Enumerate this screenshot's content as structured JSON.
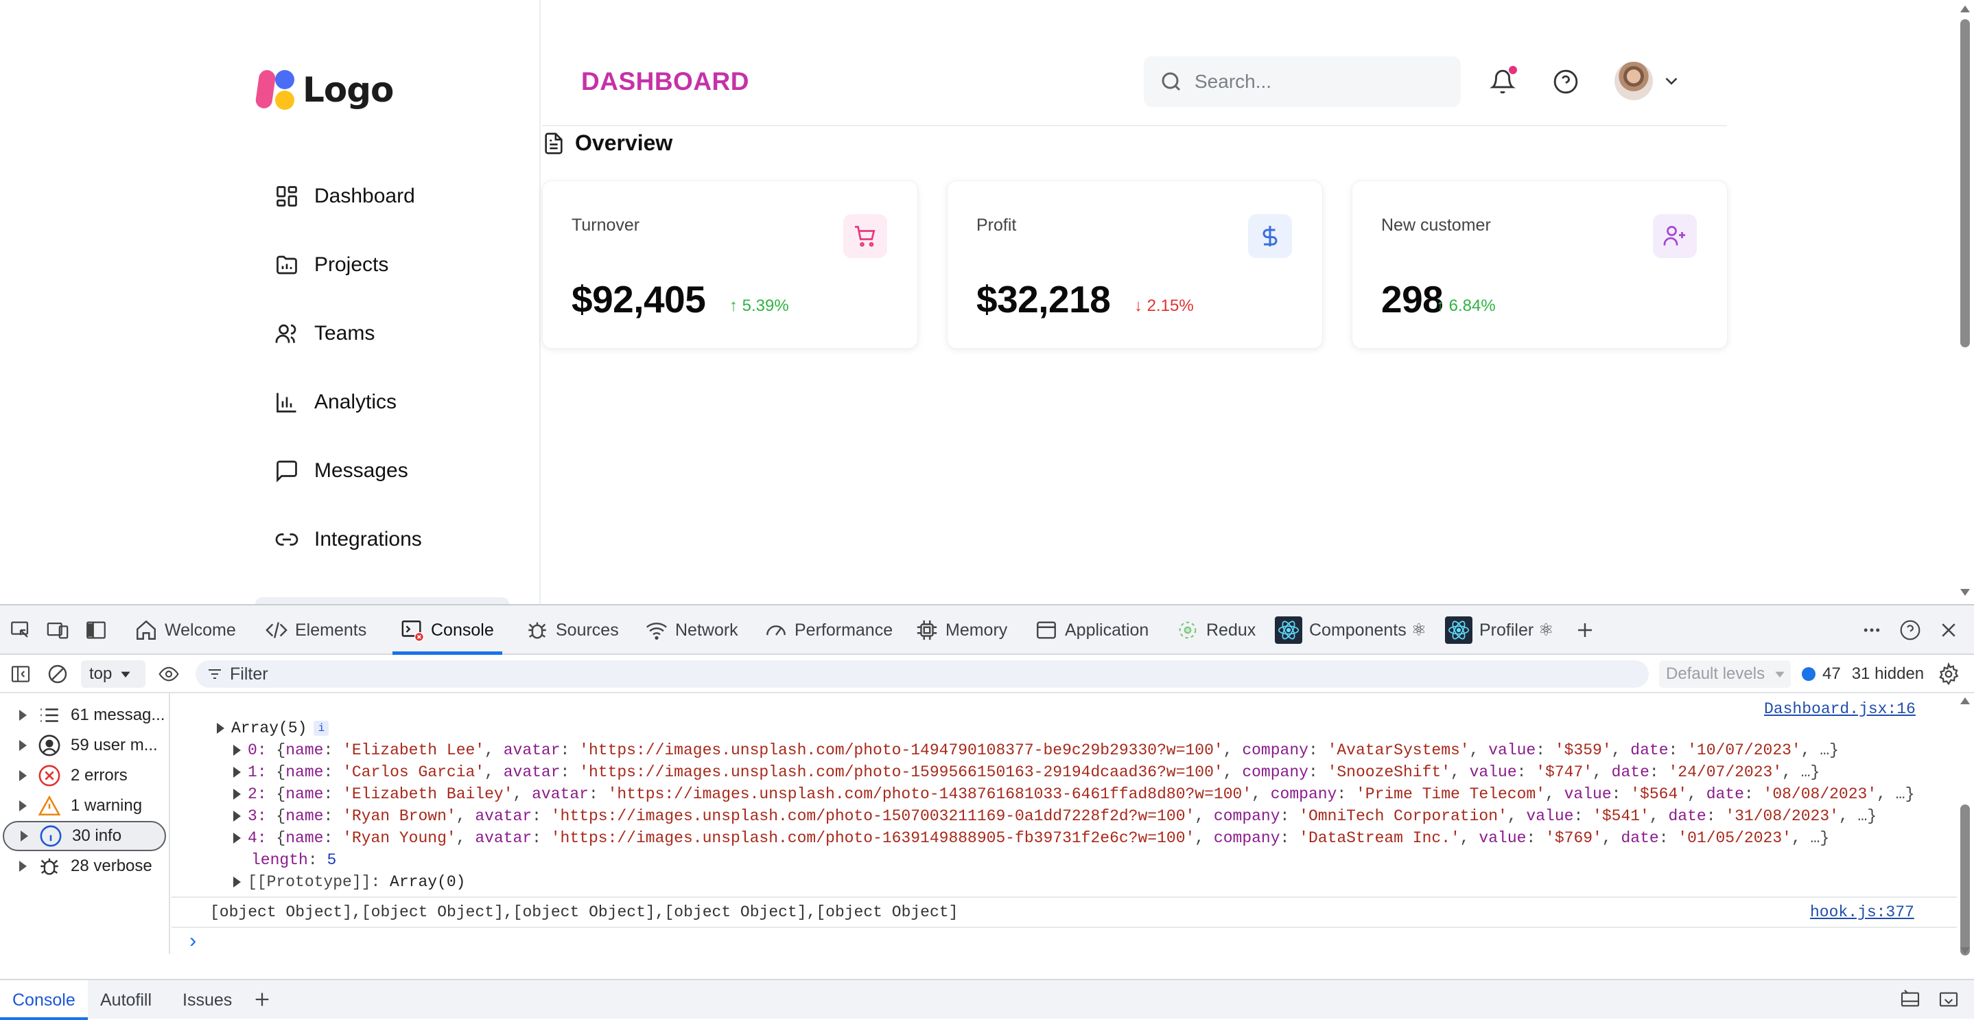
{
  "app": {
    "logo_text": "Logo",
    "nav": [
      {
        "label": "Dashboard",
        "icon": "grid-icon"
      },
      {
        "label": "Projects",
        "icon": "folder-chart-icon"
      },
      {
        "label": "Teams",
        "icon": "users-icon"
      },
      {
        "label": "Analytics",
        "icon": "bar-chart-icon"
      },
      {
        "label": "Messages",
        "icon": "message-square-icon"
      },
      {
        "label": "Integrations",
        "icon": "link-icon"
      }
    ],
    "page_title": "DASHBOARD",
    "search_placeholder": "Search...",
    "overview_title": "Overview",
    "cards": [
      {
        "title": "Turnover",
        "value": "$92,405",
        "change": "↑ 5.39%",
        "trend": "up",
        "icon": "shopping-cart-icon",
        "icon_color": "#e5397f",
        "icon_bg": "#fdecf3"
      },
      {
        "title": "Profit",
        "value": "$32,218",
        "change": "↓ 2.15%",
        "trend": "down",
        "icon": "dollar-icon",
        "icon_color": "#3b6fe0",
        "icon_bg": "#ebf1fd"
      },
      {
        "title": "New customer",
        "value": "298",
        "change": "↑ 6.84%",
        "trend": "up",
        "icon": "user-plus-icon",
        "icon_color": "#a347d6",
        "icon_bg": "#f5ecfb"
      }
    ],
    "colors": {
      "accent": "#c531a8",
      "up": "#2fb344",
      "down": "#e03131"
    }
  },
  "devtools": {
    "tabs": [
      {
        "label": "Welcome",
        "icon": "home-icon"
      },
      {
        "label": "Elements",
        "icon": "code-icon"
      },
      {
        "label": "Console",
        "icon": "console-icon",
        "active": true
      },
      {
        "label": "Sources",
        "icon": "bug-icon"
      },
      {
        "label": "Network",
        "icon": "wifi-icon"
      },
      {
        "label": "Performance",
        "icon": "gauge-icon"
      },
      {
        "label": "Memory",
        "icon": "chip-icon"
      },
      {
        "label": "Application",
        "icon": "window-icon"
      },
      {
        "label": "Redux",
        "icon": "redux-icon"
      },
      {
        "label": "Components ⚛",
        "icon": "react-icon"
      },
      {
        "label": "Profiler ⚛",
        "icon": "react-icon"
      }
    ],
    "context": "top",
    "filter_placeholder": "Filter",
    "levels": "Default levels",
    "message_count": "47",
    "hidden_count": "31 hidden",
    "sidebar": [
      {
        "label": "61 messag...",
        "icon": "list-icon"
      },
      {
        "label": "59 user m...",
        "icon": "user-circle-icon"
      },
      {
        "label": "2 errors",
        "icon": "error-icon"
      },
      {
        "label": "1 warning",
        "icon": "warning-icon"
      },
      {
        "label": "30 info",
        "icon": "info-icon",
        "selected": true
      },
      {
        "label": "28 verbose",
        "icon": "bug-icon"
      }
    ],
    "log": {
      "source1": "Dashboard.jsx:16",
      "array_header": "Array(5)",
      "rows": [
        {
          "idx": "0",
          "name": "'Elizabeth Lee'",
          "avatar": "'https://images.unsplash.com/photo-1494790108377-be9c29b29330?w=100'",
          "company": "'AvatarSystems'",
          "value": "'$359'",
          "date": "'10/07/2023'"
        },
        {
          "idx": "1",
          "name": "'Carlos Garcia'",
          "avatar": "'https://images.unsplash.com/photo-1599566150163-29194dcaad36?w=100'",
          "company": "'SnoozeShift'",
          "value": "'$747'",
          "date": "'24/07/2023'"
        },
        {
          "idx": "2",
          "name": "'Elizabeth Bailey'",
          "avatar": "'https://images.unsplash.com/photo-1438761681033-6461ffad8d80?w=100'",
          "company": "'Prime Time Telecom'",
          "value": "'$564'",
          "date": "'08/08/2023'"
        },
        {
          "idx": "3",
          "name": "'Ryan Brown'",
          "avatar": "'https://images.unsplash.com/photo-1507003211169-0a1dd7228f2d?w=100'",
          "company": "'OmniTech Corporation'",
          "value": "'$541'",
          "date": "'31/08/2023'"
        },
        {
          "idx": "4",
          "name": "'Ryan Young'",
          "avatar": "'https://images.unsplash.com/photo-1639149888905-fb39731f2e6c?w=100'",
          "company": "'DataStream Inc.'",
          "value": "'$769'",
          "date": "'01/05/2023'"
        }
      ],
      "length_key": "length",
      "length_value": "5",
      "prototype_key": "[[Prototype]]",
      "prototype_value": "Array(0)",
      "object_line": "[object Object],[object Object],[object Object],[object Object],[object Object]",
      "source2": "hook.js:377"
    },
    "drawer_tabs": [
      "Console",
      "Autofill",
      "Issues"
    ]
  }
}
